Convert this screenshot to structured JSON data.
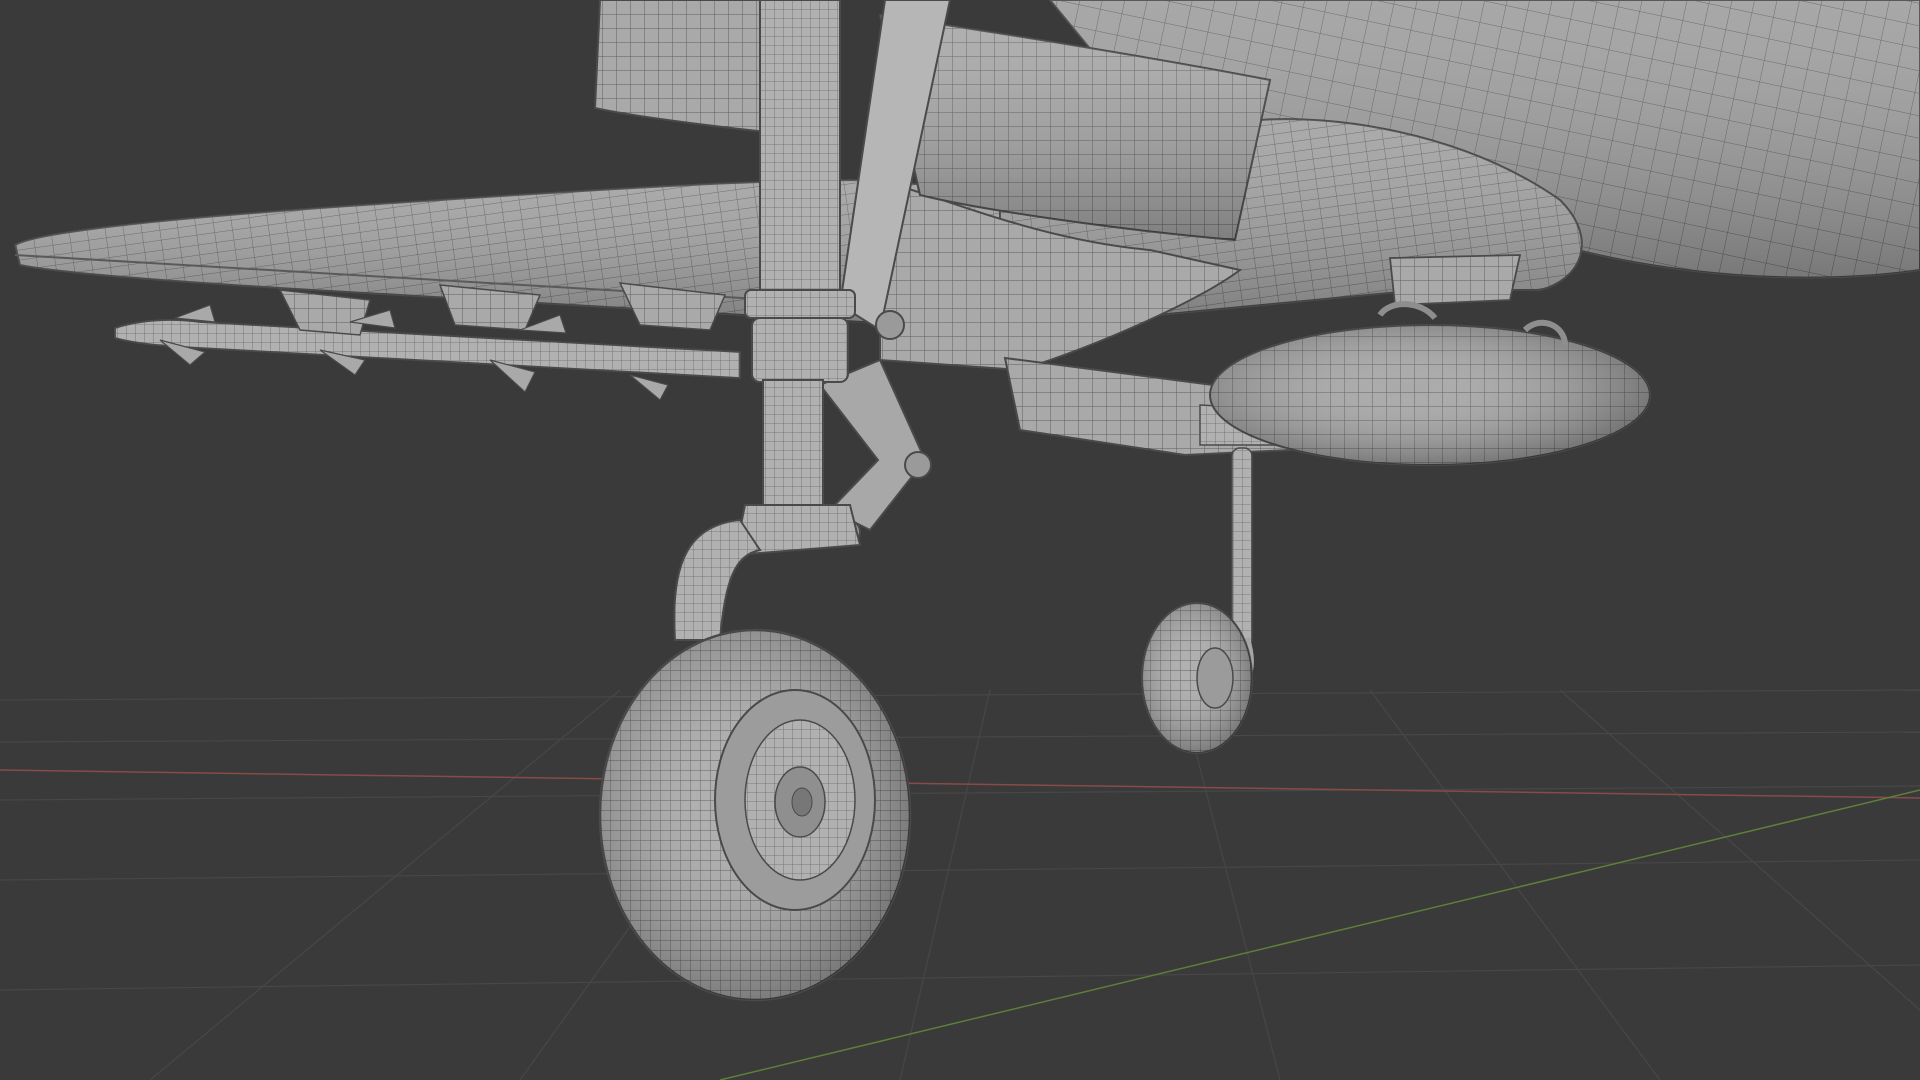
{
  "viewport": {
    "kind": "3d-viewport",
    "shading": "wireframe-overlay",
    "subject": "aircraft-underside-landing-gear",
    "background_color": "#3a3a3a",
    "grid_color": "#474747",
    "x_axis_color": "#8a4a4a",
    "y_axis_color": "#5d7f3a",
    "mesh_color": "#a6a6a6",
    "wire_color": "#5e5e5e"
  }
}
